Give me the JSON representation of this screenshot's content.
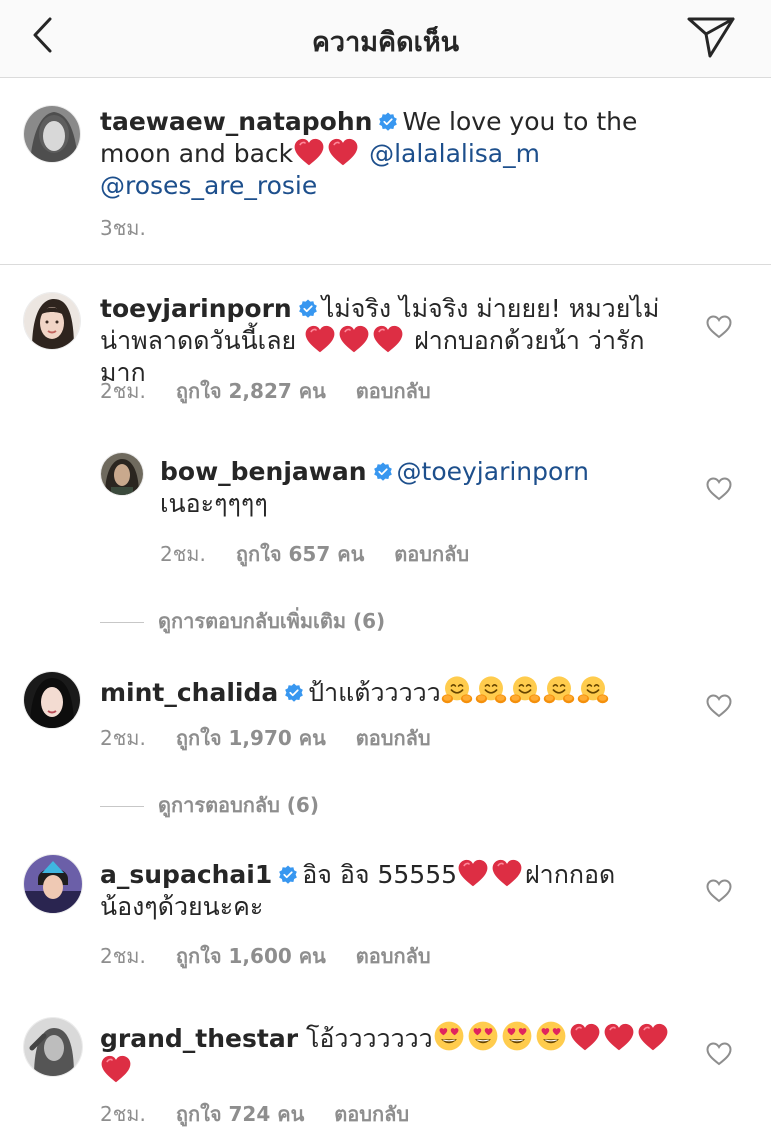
{
  "header": {
    "title": "ความคิดเห็น"
  },
  "caption": {
    "username": "taewaew_natapohn",
    "text": "We love you to the moon and back",
    "mention1": "@lalalalisa_m",
    "mention2": "@roses_are_rosie",
    "time": "3ชม."
  },
  "comments": [
    {
      "username": "toeyjarinporn",
      "text1": "ไม่จริง ไม่จริง ม่ายยย! หมวยไม่น่าพลาดดวันนี้เลย",
      "text2": "ฝากบอกด้วยน้า ว่ารักมาก",
      "time": "2ชม.",
      "likes": "ถูกใจ 2,827 คน",
      "reply": "ตอบกลับ"
    },
    {
      "username": "mint_chalida",
      "text1": "ป้าแต้ววววว",
      "time": "2ชม.",
      "likes": "ถูกใจ 1,970 คน",
      "reply": "ตอบกลับ",
      "more_replies": "ดูการตอบกลับ (6)"
    },
    {
      "username": "a_supachai1",
      "text1": "อิจ อิจ 55555",
      "text2": "ฝากกอดน้องๆด้วยนะคะ",
      "time": "2ชม.",
      "likes": "ถูกใจ 1,600 คน",
      "reply": "ตอบกลับ"
    },
    {
      "username": "grand_thestar",
      "text1": "โอ้ววววววว",
      "time": "2ชม.",
      "likes": "ถูกใจ 724 คน",
      "reply": "ตอบกลับ"
    }
  ],
  "reply": {
    "username": "bow_benjawan",
    "mention": "@toeyjarinporn",
    "text": "เนอะๆๆๆๆ",
    "time": "2ชม.",
    "likes": "ถูกใจ 657 คน",
    "reply": "ตอบกลับ",
    "more_replies": "ดูการตอบกลับเพิ่มเติม (6)"
  },
  "icons": {
    "back": "chevron-left-icon",
    "send": "paper-plane-icon",
    "verified": "verified-badge-icon",
    "like": "heart-outline-icon",
    "red_heart": "red-heart-emoji",
    "hugging_face": "hugging-face-emoji",
    "heart_eyes": "heart-eyes-emoji"
  },
  "colors": {
    "verified": "#3897f0",
    "mention": "#1d4f8c",
    "meta": "#8e8e8e",
    "heart": "#e0245e"
  }
}
